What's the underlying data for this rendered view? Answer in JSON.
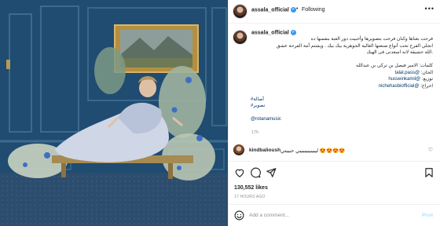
{
  "header": {
    "username": "assala_official",
    "dot": "•",
    "follow_label": "Following",
    "more_label": "•••"
  },
  "caption": {
    "username": "assala_official",
    "lines": [
      "فرحت بغناها وكنان فرحت بتصويرها وأحبيت دور العبة بنفسها ده",
      "انجلي الفرح تحت أنواع صنعتها الغالية الجوهرية بيك بيك . ويشتم أمة الفرحة عشق",
      ".الله حشيقة لانه اسعدنى فى الهيك"
    ],
    "credits_title": "كلمات: الامير فيصل بن تركي بن عبدالله",
    "credits": [
      {
        "label": "الحان:",
        "handle": "@talal.pass"
      },
      {
        "label": "توزيع:",
        "handle": "@husseinkamil"
      },
      {
        "label": "اخراج:",
        "handle": "@nichehasbiofficial"
      }
    ],
    "hashtag_line_1": "#أصالة",
    "hashtag_line_2": "#تصوير",
    "music_tag": "@rotanamusic",
    "time_ago": "17h"
  },
  "comment": {
    "username": "kindbalioush",
    "text": "ليبيبيبيببيبي حبيبتي 😍😍😍😍"
  },
  "actions": {
    "likes_count": "130,552",
    "likes_word": "likes",
    "date_label": "17 HOURS AGO"
  },
  "add_comment": {
    "placeholder": "Add a comment...",
    "post_label": "Post"
  },
  "colors": {
    "link": "#00376b",
    "verified": "#3897f0",
    "post_disabled": "#b2dffc",
    "media_wall": "#1f4f73"
  },
  "icons": [
    "verified-icon",
    "more-icon",
    "heart-icon",
    "comment-icon",
    "share-icon",
    "save-icon",
    "emoji-icon"
  ]
}
